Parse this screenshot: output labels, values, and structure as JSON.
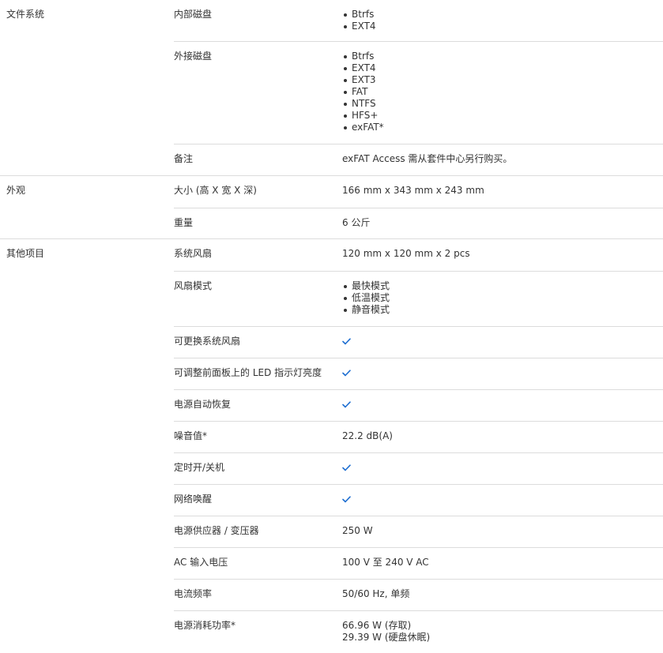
{
  "accent_color": "#1f6fd1",
  "sections": {
    "filesystem": {
      "category": "文件系统",
      "internal": {
        "label": "内部磁盘",
        "items": [
          "Btrfs",
          "EXT4"
        ]
      },
      "external": {
        "label": "外接磁盘",
        "items": [
          "Btrfs",
          "EXT4",
          "EXT3",
          "FAT",
          "NTFS",
          "HFS+",
          "exFAT*"
        ]
      },
      "note": {
        "label": "备注",
        "value": "exFAT Access 需从套件中心另行购买。"
      }
    },
    "appearance": {
      "category": "外观",
      "size": {
        "label": "大小 (高 X 宽 X 深)",
        "value": "166 mm x 343 mm x 243 mm"
      },
      "weight": {
        "label": "重量",
        "value": "6 公斤"
      }
    },
    "other": {
      "category": "其他项目",
      "fan": {
        "label": "系统风扇",
        "value": "120 mm x 120 mm x 2 pcs"
      },
      "fan_mode": {
        "label": "风扇模式",
        "items": [
          "最快模式",
          "低温模式",
          "静音模式"
        ]
      },
      "replaceable_fan": {
        "label": "可更换系统风扇",
        "icon": "checkmark-icon"
      },
      "led_brightness": {
        "label": "可调整前面板上的 LED 指示灯亮度",
        "icon": "checkmark-icon"
      },
      "power_recovery": {
        "label": "电源自动恢复",
        "icon": "checkmark-icon"
      },
      "noise": {
        "label": "噪音值*",
        "value": "22.2 dB(A)"
      },
      "scheduled_power": {
        "label": "定时开/关机",
        "icon": "checkmark-icon"
      },
      "wol": {
        "label": "网络唤醒",
        "icon": "checkmark-icon"
      },
      "psu": {
        "label": "电源供应器 / 变压器",
        "value": "250 W"
      },
      "ac_voltage": {
        "label": "AC 输入电压",
        "value": "100 V 至 240 V AC"
      },
      "frequency": {
        "label": "电流频率",
        "value": "50/60 Hz, 单频"
      },
      "power_consumption": {
        "label": "电源消耗功率*",
        "values": [
          "66.96 W (存取)",
          "29.39 W (硬盘休眠)"
        ]
      }
    }
  }
}
